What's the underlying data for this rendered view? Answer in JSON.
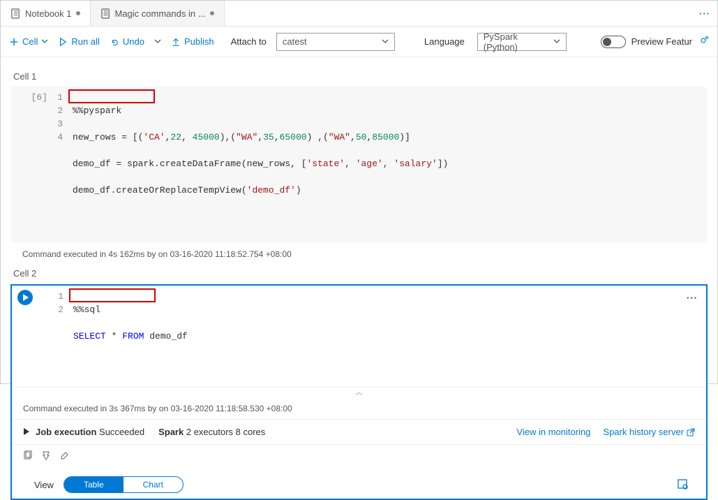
{
  "tabs": [
    {
      "label": "Notebook 1",
      "dirty": true
    },
    {
      "label": "Magic commands in ...",
      "dirty": true
    }
  ],
  "toolbar": {
    "cell": "Cell",
    "run_all": "Run all",
    "undo": "Undo",
    "publish": "Publish",
    "attach_label": "Attach to",
    "attach_value": "catest",
    "language_label": "Language",
    "language_value": "PySpark (Python)",
    "preview_label": "Preview Featur"
  },
  "cell1": {
    "label": "Cell 1",
    "exec_count": "[6]",
    "lines": [
      "1",
      "2",
      "3",
      "4"
    ],
    "code": {
      "l1": "%%pyspark",
      "l2_pre": "new_rows = [(",
      "l2_s1": "'CA'",
      "l2_c1": ",",
      "l2_n1": "22",
      "l2_c2": ", ",
      "l2_n2": "45000",
      "l2_mid": "),(",
      "l2_s2": "\"WA\"",
      "l2_c3": ",",
      "l2_n3": "35",
      "l2_c4": ",",
      "l2_n4": "65000",
      "l2_mid2": ") ,(",
      "l2_s3": "\"WA\"",
      "l2_c5": ",",
      "l2_n5": "50",
      "l2_c6": ",",
      "l2_n6": "85000",
      "l2_end": ")]",
      "l3_pre": "demo_df = spark.createDataFrame(new_rows, [",
      "l3_s1": "'state'",
      "l3_c1": ", ",
      "l3_s2": "'age'",
      "l3_c2": ", ",
      "l3_s3": "'salary'",
      "l3_end": "])",
      "l4_pre": "demo_df.createOrReplaceTempView(",
      "l4_s1": "'demo_df'",
      "l4_end": ")"
    },
    "status": "Command executed in 4s 162ms by       on 03-16-2020 11:18:52.754 +08:00"
  },
  "cell2": {
    "label": "Cell 2",
    "lines": [
      "1",
      "2"
    ],
    "code": {
      "l1": "%%sql",
      "l2_kw1": "SELECT",
      "l2_mid": " * ",
      "l2_kw2": "FROM",
      "l2_rest": " demo_df"
    },
    "status": "Command executed in 3s 367ms by       on 03-16-2020 11:18:58.530 +08:00",
    "job_label": "Job execution",
    "job_status": " Succeeded",
    "spark_label": "Spark",
    "spark_detail": " 2 executors 8 cores",
    "link1": "View in monitoring",
    "link2": "Spark history server",
    "view_label": "View",
    "seg_table": "Table",
    "seg_chart": "Chart"
  }
}
